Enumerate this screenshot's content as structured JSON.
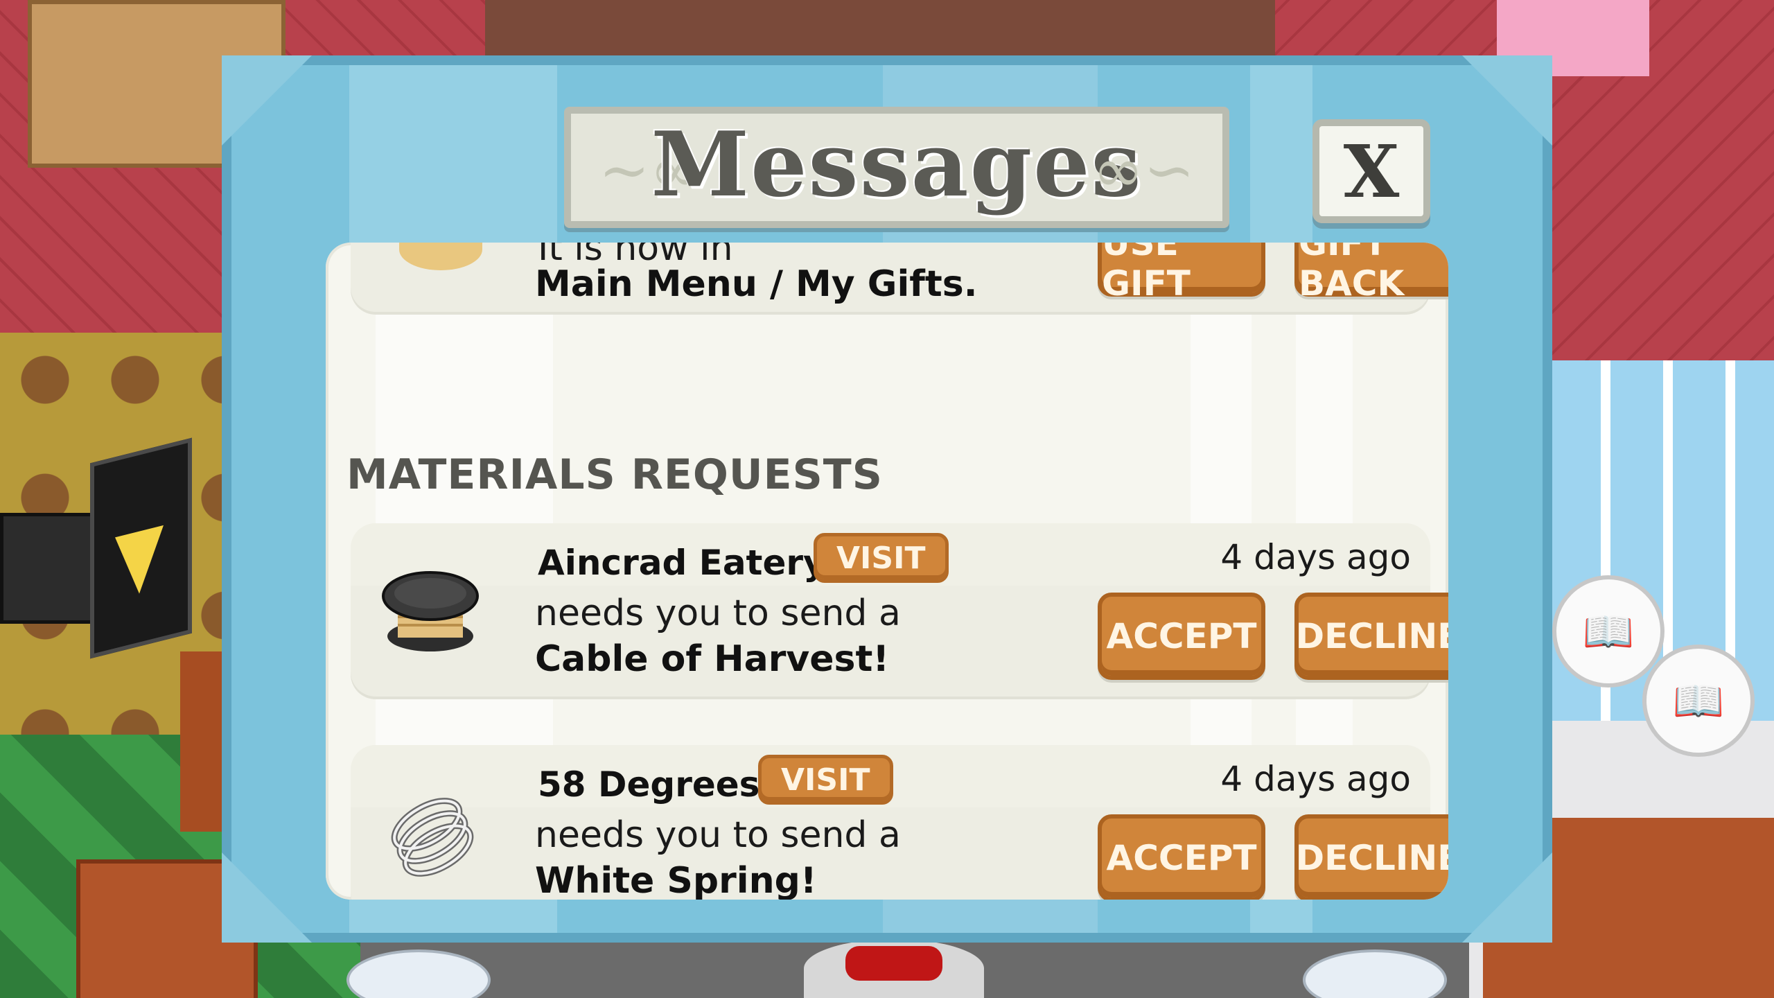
{
  "dialog": {
    "title": "Messages",
    "close_label": "X"
  },
  "gift": {
    "partial_text": "It is now in",
    "location_text": "Main Menu / My Gifts.",
    "use_gift_label": "USE GIFT",
    "gift_back_label": "GIFT BACK"
  },
  "materials": {
    "section_title": "MATERIALS REQUESTS",
    "requests": [
      {
        "sender": "Aincrad Eatery",
        "visit_label": "VISIT",
        "time_ago": "4 days ago",
        "line1": "needs you to send a",
        "item": "Cable of Harvest!",
        "icon": "cable-spool-icon",
        "accept_label": "ACCEPT",
        "decline_label": "DECLINE"
      },
      {
        "sender": "58 Degrees",
        "visit_label": "VISIT",
        "time_ago": "4 days ago",
        "line1": "needs you to send a",
        "item": "White Spring!",
        "icon": "spring-coil-icon",
        "accept_label": "ACCEPT",
        "decline_label": "DECLINE"
      }
    ]
  },
  "colors": {
    "dialog_frame": "#7cc3dc",
    "button_orange": "#d0853a",
    "panel_bg": "#f6f6ef"
  }
}
